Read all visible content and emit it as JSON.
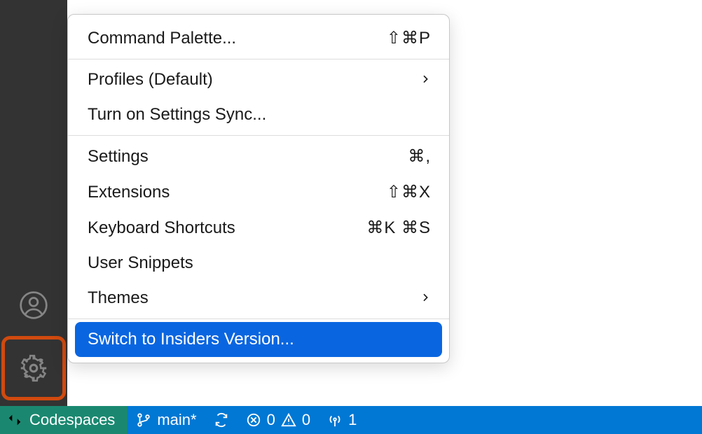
{
  "menu": {
    "command_palette": {
      "label": "Command Palette...",
      "shortcut": "⇧⌘P"
    },
    "profiles": {
      "label": "Profiles (Default)"
    },
    "settings_sync": {
      "label": "Turn on Settings Sync..."
    },
    "settings": {
      "label": "Settings",
      "shortcut": "⌘,"
    },
    "extensions": {
      "label": "Extensions",
      "shortcut": "⇧⌘X"
    },
    "keyboard_shortcuts": {
      "label": "Keyboard Shortcuts",
      "shortcut": "⌘K ⌘S"
    },
    "user_snippets": {
      "label": "User Snippets"
    },
    "themes": {
      "label": "Themes"
    },
    "switch_insiders": {
      "label": "Switch to Insiders Version..."
    }
  },
  "status_bar": {
    "codespaces": "Codespaces",
    "branch": "main*",
    "errors": "0",
    "warnings": "0",
    "ports": "1"
  }
}
